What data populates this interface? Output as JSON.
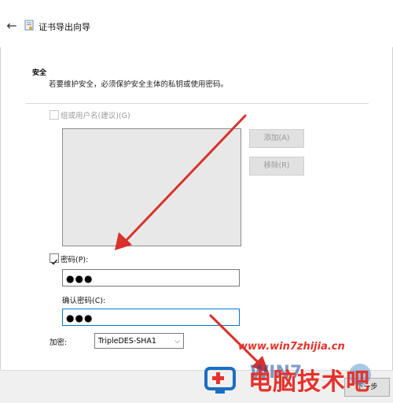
{
  "window": {
    "title": "证书导出向导"
  },
  "section": {
    "title": "安全",
    "description": "若要维护安全，必须保护安全主体的私钥或使用密码。"
  },
  "group_option": {
    "label": "组或用户名(建议)(G)",
    "checked": false,
    "enabled": false
  },
  "buttons": {
    "add": "添加(A)",
    "remove": "移除(R)",
    "next": "下一步"
  },
  "password": {
    "label": "密码(P):",
    "checked": true,
    "value": "●●●"
  },
  "confirm_password": {
    "label": "确认密码(C):",
    "value": "●●●"
  },
  "encryption": {
    "label": "加密:",
    "selected": "TripleDES-SHA1"
  },
  "watermark": {
    "url": "www.win7zhijia.cn",
    "brand": "电脑技术吧",
    "logo_text": "WIN7"
  },
  "colors": {
    "accent_focus": "#0078d7",
    "annotation_red": "#d9312b",
    "watermark_red": "#e5322c"
  },
  "icons": {
    "back": "arrow-left-icon",
    "cert": "certificate-icon"
  }
}
